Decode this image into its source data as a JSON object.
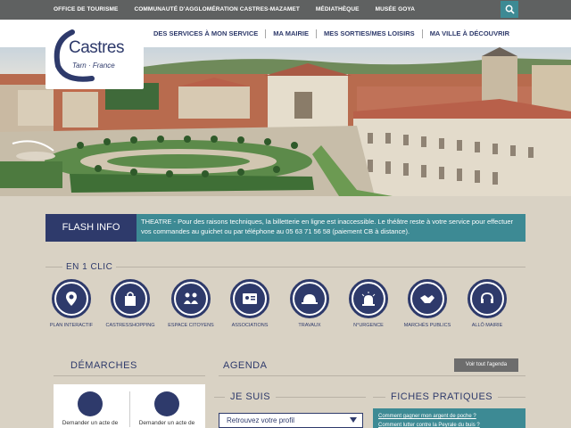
{
  "topbar": {
    "links": [
      "OFFICE DE TOURISME",
      "COMMUNAUTÉ D'AGGLOMÉRATION CASTRES-MAZAMET",
      "MÉDIATHÈQUE",
      "MUSÉE GOYA"
    ],
    "search_icon": "search-icon"
  },
  "logo": {
    "name": "Castres",
    "tagline": "Tarn · France"
  },
  "nav": {
    "items": [
      "DES SERVICES À MON SERVICE",
      "MA MAIRIE",
      "MES SORTIES/MES LOISIRS",
      "MA VILLE À DÉCOUVRIR"
    ]
  },
  "flash": {
    "label": "FLASH INFO",
    "text": "THEATRE - Pour des raisons techniques, la billetterie en ligne est inaccessible. Le théâtre reste à votre service pour effectuer vos commandes au guichet ou par téléphone au 05 63 71 56 58 (paiement CB à distance)."
  },
  "en1clic": {
    "title": "EN 1 CLIC",
    "items": [
      {
        "label": "PLAN INTERACTIF",
        "icon": "map-pin-icon"
      },
      {
        "label": "CASTRESSHOPPING",
        "icon": "shopping-bag-icon"
      },
      {
        "label": "ESPACE CITOYENS",
        "icon": "citizens-icon"
      },
      {
        "label": "ASSOCIATIONS",
        "icon": "id-card-icon"
      },
      {
        "label": "TRAVAUX",
        "icon": "hard-hat-icon"
      },
      {
        "label": "N°URGENCE",
        "icon": "alarm-icon"
      },
      {
        "label": "MARCHÉS PUBLICS",
        "icon": "handshake-icon"
      },
      {
        "label": "ALLÔ MAIRIE",
        "icon": "headset-icon"
      }
    ]
  },
  "demarches": {
    "title": "DÉMARCHES",
    "cards": [
      {
        "text": "Demander un acte de"
      },
      {
        "text": "Demander un acte de"
      }
    ]
  },
  "agenda": {
    "title": "AGENDA",
    "button": "Voir tout l'agenda"
  },
  "jesuis": {
    "title": "JE SUIS",
    "select_value": "Retrouvez votre profil"
  },
  "fiches": {
    "title": "FICHES PRATIQUES",
    "links": [
      "Comment gagner mon argent de poche ?",
      "Comment lutter contre la Peyrale du buis ?"
    ]
  },
  "colors": {
    "navy": "#2e3a6b",
    "teal": "#3d8a94",
    "background": "#d9d2c4",
    "topbar": "#5f6161"
  }
}
